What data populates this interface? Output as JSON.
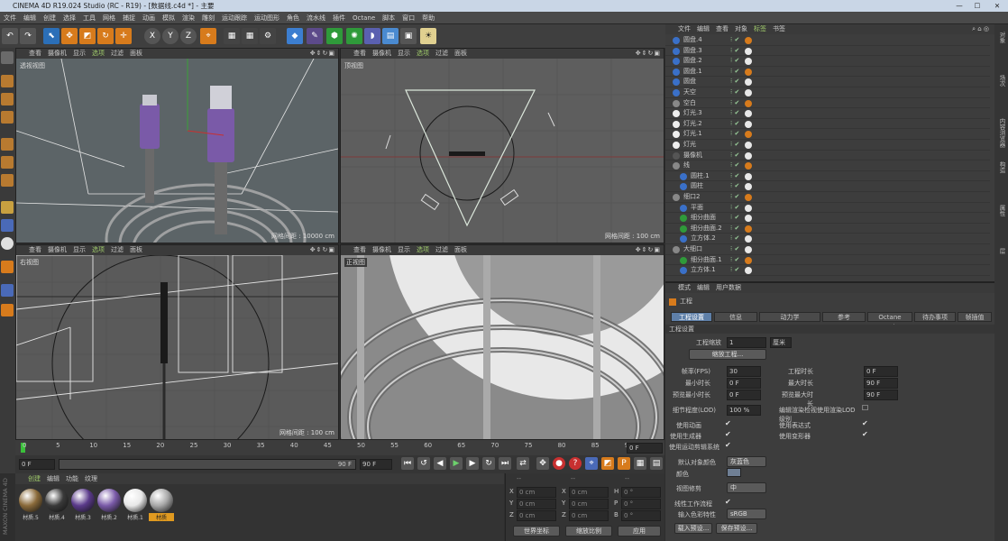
{
  "window": {
    "title": "CINEMA 4D R19.024 Studio (RC - R19) - [数据线.c4d *] - 主要"
  },
  "menubar": {
    "items": [
      "文件",
      "编辑",
      "创建",
      "选择",
      "工具",
      "网格",
      "捕捉",
      "动画",
      "模拟",
      "渲染",
      "雕刻",
      "运动跟踪",
      "运动图形",
      "角色",
      "流水线",
      "插件",
      "Octane",
      "脚本",
      "窗口",
      "帮助"
    ],
    "layout_label": "界面",
    "layout_value": "启动"
  },
  "viewports": [
    {
      "menu": [
        "查看",
        "摄像机",
        "显示",
        "选项",
        "过滤",
        "面板"
      ],
      "active": 3,
      "label": "透视视图",
      "footer": ""
    },
    {
      "menu": [
        "查看",
        "摄像机",
        "显示",
        "选项",
        "过滤",
        "面板"
      ],
      "active": 3,
      "label": "顶视图",
      "footer": "网格间距 : 100 cm"
    },
    {
      "menu": [
        "查看",
        "摄像机",
        "显示",
        "选项",
        "过滤",
        "面板"
      ],
      "active": 3,
      "label": "右视图",
      "footer": "网格间距 : 100 cm"
    },
    {
      "menu": [
        "查看",
        "摄像机",
        "显示",
        "选项",
        "过滤",
        "面板"
      ],
      "active": 3,
      "label": "正视图",
      "footer": ""
    }
  ],
  "viewport1_footer": "网格间距 : 10000 cm",
  "timeline": {
    "ticks": [
      "0",
      "5",
      "10",
      "15",
      "20",
      "25",
      "30",
      "35",
      "40",
      "45",
      "50",
      "55",
      "60",
      "65",
      "70",
      "75",
      "80",
      "85",
      "90"
    ],
    "current_frame": "0 F"
  },
  "transport": {
    "start": "0 F",
    "end_small": "90 F",
    "end": "90 F",
    "range_start": "0 F"
  },
  "materials": {
    "tabs": [
      "创建",
      "编辑",
      "功能",
      "纹理"
    ],
    "items": [
      {
        "name": "材质.5",
        "color": "#8a6a3a"
      },
      {
        "name": "材质.4",
        "color": "#3a3a3a"
      },
      {
        "name": "材质.3",
        "color": "#5a3a8a"
      },
      {
        "name": "材质.2",
        "color": "#7a5aa8"
      },
      {
        "name": "材质.1",
        "color": "#e8e8e8"
      },
      {
        "name": "材质",
        "color": "#a8a8a8"
      }
    ],
    "side_label": "MAXON CINEMA 4D"
  },
  "coords": {
    "headers": [
      "--",
      "--",
      "--"
    ],
    "rows": [
      {
        "a": "X",
        "av": "0 cm",
        "b": "X",
        "bv": "0 cm",
        "c": "H",
        "cv": "0 °"
      },
      {
        "a": "Y",
        "av": "0 cm",
        "b": "Y",
        "bv": "0 cm",
        "c": "P",
        "cv": "0 °"
      },
      {
        "a": "Z",
        "av": "0 cm",
        "b": "Z",
        "bv": "0 cm",
        "c": "B",
        "cv": "0 °"
      }
    ],
    "world": "世界坐标",
    "scale": "缩放比例",
    "apply": "应用"
  },
  "objects": {
    "menu": [
      "文件",
      "编辑",
      "查看",
      "对象",
      "标签",
      "书签"
    ],
    "rows": [
      {
        "name": "圆盘.4",
        "indent": 0
      },
      {
        "name": "圆盘.3",
        "indent": 0
      },
      {
        "name": "圆盘.2",
        "indent": 0
      },
      {
        "name": "圆盘.1",
        "indent": 0
      },
      {
        "name": "圆盘",
        "indent": 0
      },
      {
        "name": "天空",
        "indent": 0
      },
      {
        "name": "空白",
        "indent": 0
      },
      {
        "name": "灯光.3",
        "indent": 0
      },
      {
        "name": "灯光.2",
        "indent": 0
      },
      {
        "name": "灯光.1",
        "indent": 0
      },
      {
        "name": "灯光",
        "indent": 0
      },
      {
        "name": "摄像机",
        "indent": 0
      },
      {
        "name": "线",
        "indent": 0
      },
      {
        "name": "圆柱.1",
        "indent": 1
      },
      {
        "name": "圆柱",
        "indent": 1
      },
      {
        "name": "细口2",
        "indent": 0
      },
      {
        "name": "平面",
        "indent": 1
      },
      {
        "name": "细分曲面",
        "indent": 1
      },
      {
        "name": "细分曲面.2",
        "indent": 1
      },
      {
        "name": "立方体.2",
        "indent": 1
      },
      {
        "name": "大细口",
        "indent": 0
      },
      {
        "name": "细分曲面.1",
        "indent": 1
      },
      {
        "name": "立方体.1",
        "indent": 1
      }
    ]
  },
  "attributes": {
    "menu": [
      "模式",
      "编辑",
      "用户数据"
    ],
    "title": "工程",
    "tabs": [
      "工程设置",
      "信息",
      "动力学",
      "参考",
      "Octane Render",
      "待办事项",
      "帧插值"
    ],
    "section": "工程设置",
    "scale_label": "工程缩放",
    "scale_value": "1",
    "scale_unit": "厘米",
    "scale_button": "缩放工程...",
    "fps_label": "帧率(FPS)",
    "fps_value": "30",
    "project_time_label": "工程时长",
    "project_time_value": "0 F",
    "min_time_label": "最小时长",
    "min_time_value": "0 F",
    "max_time_label": "最大时长",
    "max_time_value": "90 F",
    "preview_min_label": "预览最小时长",
    "preview_min_value": "0 F",
    "preview_max_label": "预览最大时长",
    "preview_max_value": "90 F",
    "lod_label": "细节程度(LOD)",
    "lod_value": "100 %",
    "lod_render_label": "编辑渲染检视使用渲染LOD级别",
    "use_anim_label": "使用动画",
    "use_expr_label": "使用表达式",
    "use_gen_label": "使用生成器",
    "use_deform_label": "使用变形器",
    "use_motion_label": "使用运动剪辑系统",
    "default_color_label": "默认对象颜色",
    "default_color_value": "灰蓝色",
    "color_label": "颜色",
    "view_clip_label": "视图修剪",
    "view_clip_value": "中",
    "linear_label": "线性工作流程",
    "input_color_label": "输入色彩特性",
    "input_color_value": "sRGB",
    "load_preset": "载入预设...",
    "save_preset": "保存预设..."
  },
  "right_strip": [
    "对象",
    "场次",
    "内容浏览器",
    "构造",
    "属性",
    "层"
  ]
}
